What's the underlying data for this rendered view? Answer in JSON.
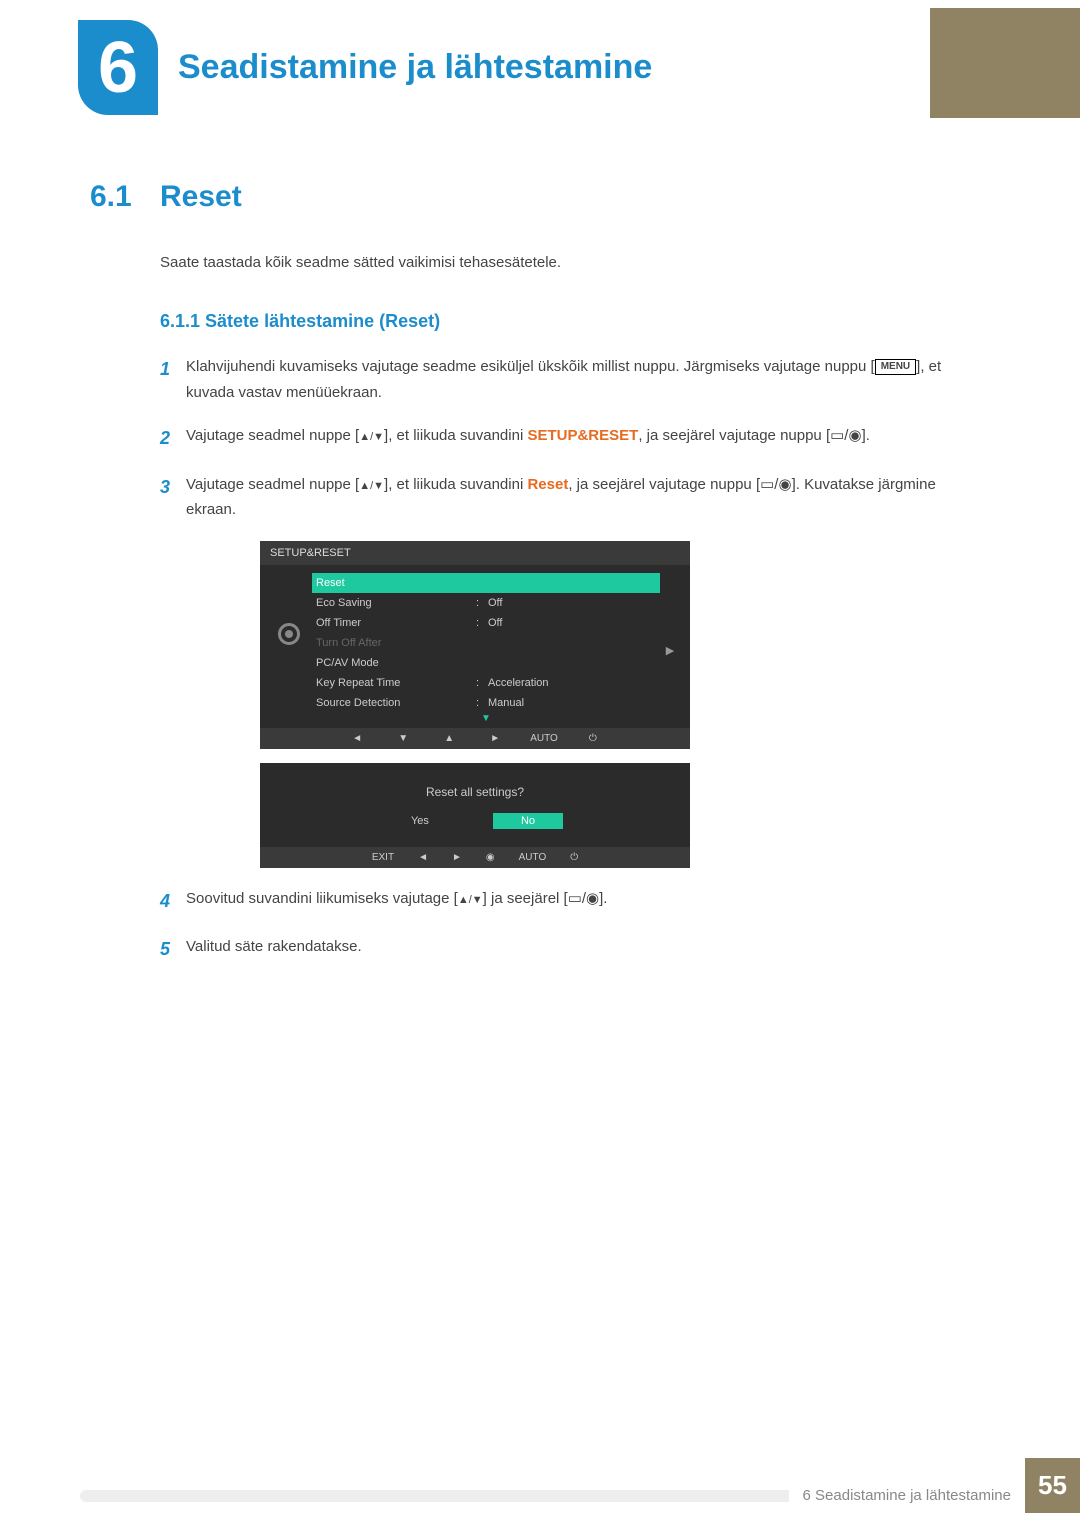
{
  "chapter": {
    "number": "6",
    "title": "Seadistamine ja lähtestamine"
  },
  "section": {
    "number": "6.1",
    "title": "Reset"
  },
  "intro": "Saate taastada kõik seadme sätted vaikimisi tehasesätetele.",
  "subsection": "6.1.1 Sätete lähtestamine (Reset)",
  "steps": {
    "s1": {
      "num": "1",
      "a": "Klahvijuhendi kuvamiseks vajutage seadme esiküljel ükskõik millist nuppu. Järgmiseks vajutage nuppu [",
      "menu": "MENU",
      "b": "], et kuvada vastav menüüekraan."
    },
    "s2": {
      "num": "2",
      "a": "Vajutage seadmel nuppe [",
      "b": "], et liikuda suvandini ",
      "hl": "SETUP&RESET",
      "c": ", ja seejärel vajutage nuppu [",
      "d": "]."
    },
    "s3": {
      "num": "3",
      "a": "Vajutage seadmel nuppe [",
      "b": "], et liikuda suvandini ",
      "hl": "Reset",
      "c": ", ja seejärel vajutage nuppu [",
      "d": "]. Kuvatakse järgmine ekraan."
    },
    "s4": {
      "num": "4",
      "a": "Soovitud suvandini liikumiseks vajutage [",
      "b": "] ja seejärel [",
      "c": "]."
    },
    "s5": {
      "num": "5",
      "a": "Valitud säte rakendatakse."
    }
  },
  "osd": {
    "title": "SETUP&RESET",
    "items": [
      {
        "label": "Reset",
        "value": "",
        "state": "selected"
      },
      {
        "label": "Eco Saving",
        "value": "Off",
        "state": ""
      },
      {
        "label": "Off Timer",
        "value": "Off",
        "state": ""
      },
      {
        "label": "Turn Off After",
        "value": "",
        "state": "dim"
      },
      {
        "label": "PC/AV Mode",
        "value": "",
        "state": ""
      },
      {
        "label": "Key Repeat Time",
        "value": "Acceleration",
        "state": ""
      },
      {
        "label": "Source Detection",
        "value": "Manual",
        "state": ""
      }
    ],
    "footer": {
      "auto": "AUTO"
    }
  },
  "confirm": {
    "question": "Reset all settings?",
    "yes": "Yes",
    "no": "No",
    "footer": {
      "exit": "EXIT",
      "auto": "AUTO"
    }
  },
  "footer": {
    "text": "6 Seadistamine ja lähtestamine",
    "page": "55"
  }
}
